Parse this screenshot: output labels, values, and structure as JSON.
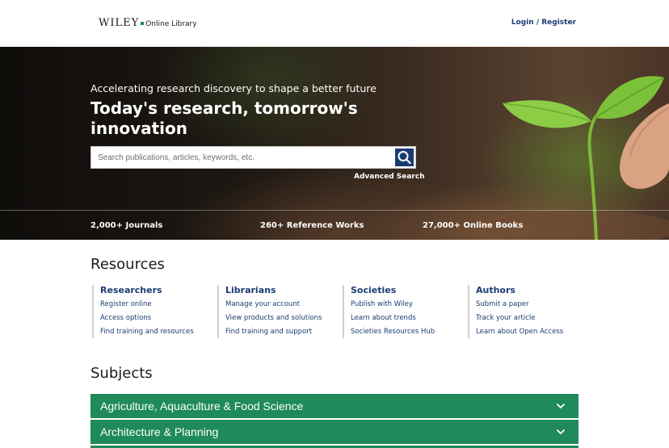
{
  "header": {
    "logo_brand": "WILEY",
    "logo_sub": "Online Library",
    "login_label": "Login / Register"
  },
  "hero": {
    "subtitle": "Accelerating research discovery to shape a better future",
    "title": "Today's research, tomorrow's innovation",
    "search_placeholder": "Search publications, articles, keywords, etc.",
    "advanced_search_label": "Advanced Search",
    "stats": [
      "2,000+ Journals",
      "260+ Reference Works",
      "27,000+ Online Books"
    ]
  },
  "resources": {
    "title": "Resources",
    "columns": [
      {
        "heading": "Researchers",
        "links": [
          "Register online",
          "Access options",
          "Find training and resources"
        ]
      },
      {
        "heading": "Librarians",
        "links": [
          "Manage your account",
          "View products and solutions",
          "Find training and support"
        ]
      },
      {
        "heading": "Societies",
        "links": [
          "Publish with Wiley",
          "Learn about trends",
          "Societies Resources Hub"
        ]
      },
      {
        "heading": "Authors",
        "links": [
          "Submit a paper",
          "Track your article",
          "Learn about Open Access"
        ]
      }
    ]
  },
  "subjects": {
    "title": "Subjects",
    "items": [
      "Agriculture, Aquaculture & Food Science",
      "Architecture & Planning"
    ]
  },
  "colors": {
    "brand_navy": "#1b3c73",
    "subject_green": "#1f8a5a"
  },
  "icons": {
    "search": "search-icon",
    "chevron": "chevron-down-icon"
  }
}
